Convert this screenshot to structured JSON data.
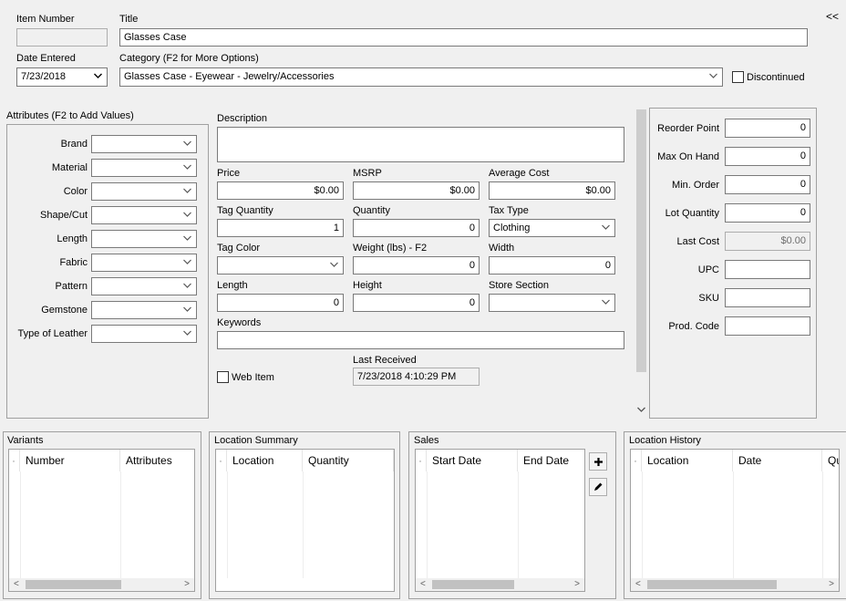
{
  "header": {
    "item_number_label": "Item Number",
    "item_number_value": "",
    "title_label": "Title",
    "title_value": "Glasses Case",
    "collapse_label": "<<",
    "date_entered_label": "Date Entered",
    "date_entered_value": "7/23/2018",
    "category_label": "Category (F2 for More Options)",
    "category_value": "Glasses Case - Eyewear - Jewelry/Accessories",
    "discontinued_label": "Discontinued"
  },
  "attributes": {
    "group_label": "Attributes (F2 to Add Values)",
    "items": [
      {
        "label": "Brand",
        "value": ""
      },
      {
        "label": "Material",
        "value": ""
      },
      {
        "label": "Color",
        "value": ""
      },
      {
        "label": "Shape/Cut",
        "value": ""
      },
      {
        "label": "Length",
        "value": ""
      },
      {
        "label": "Fabric",
        "value": ""
      },
      {
        "label": "Pattern",
        "value": ""
      },
      {
        "label": "Gemstone",
        "value": ""
      },
      {
        "label": "Type of Leather",
        "value": ""
      }
    ]
  },
  "details": {
    "description_label": "Description",
    "description_value": "",
    "price_label": "Price",
    "price_value": "$0.00",
    "msrp_label": "MSRP",
    "msrp_value": "$0.00",
    "avg_cost_label": "Average Cost",
    "avg_cost_value": "$0.00",
    "tag_qty_label": "Tag Quantity",
    "tag_qty_value": "1",
    "quantity_label": "Quantity",
    "quantity_value": "0",
    "tax_type_label": "Tax Type",
    "tax_type_value": "Clothing",
    "tag_color_label": "Tag Color",
    "tag_color_value": "",
    "weight_label": "Weight (lbs) - F2",
    "weight_value": "0",
    "width_label": "Width",
    "width_value": "0",
    "length_label": "Length",
    "length_value": "0",
    "height_label": "Height",
    "height_value": "0",
    "store_section_label": "Store Section",
    "store_section_value": "",
    "keywords_label": "Keywords",
    "keywords_value": "",
    "web_item_label": "Web Item",
    "last_received_label": "Last Received",
    "last_received_value": "7/23/2018 4:10:29 PM"
  },
  "inventory": {
    "reorder_point_label": "Reorder Point",
    "reorder_point_value": "0",
    "max_on_hand_label": "Max On Hand",
    "max_on_hand_value": "0",
    "min_order_label": "Min. Order",
    "min_order_value": "0",
    "lot_quantity_label": "Lot Quantity",
    "lot_quantity_value": "0",
    "last_cost_label": "Last Cost",
    "last_cost_value": "$0.00",
    "upc_label": "UPC",
    "upc_value": "",
    "sku_label": "SKU",
    "sku_value": "",
    "prod_code_label": "Prod. Code",
    "prod_code_value": ""
  },
  "panels": {
    "variants": {
      "label": "Variants",
      "columns": [
        "Number",
        "Attributes"
      ]
    },
    "location_summary": {
      "label": "Location Summary",
      "columns": [
        "Location",
        "Quantity"
      ]
    },
    "sales": {
      "label": "Sales",
      "columns": [
        "Start Date",
        "End Date"
      ]
    },
    "location_history": {
      "label": "Location History",
      "columns": [
        "Location",
        "Date",
        "Qu"
      ]
    }
  },
  "icons": {
    "add": "plus-icon",
    "edit": "pencil-icon",
    "dropdown": "chevron-down-icon"
  }
}
